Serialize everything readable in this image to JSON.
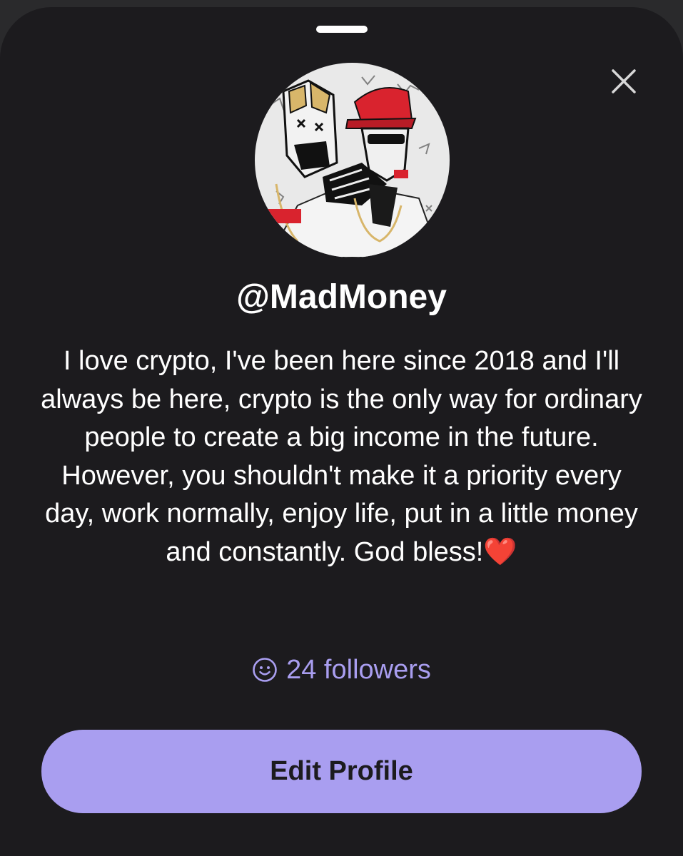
{
  "profile": {
    "username": "@MadMoney",
    "bio": "I love crypto, I've been here since 2018 and I'll always be here, crypto is the only way for ordinary people to create a big income in the future. However, you shouldn't make it a priority every day, work normally, enjoy life, put in a little money and constantly. God bless!❤️",
    "followers_label": "24 followers",
    "followers_count": 24,
    "avatar_icon": "avatar-image"
  },
  "actions": {
    "edit_label": "Edit Profile",
    "close_icon": "close-icon"
  },
  "icons": {
    "followers_icon": "smiley-face-icon"
  },
  "colors": {
    "sheet_background": "#1c1b1e",
    "accent": "#a99ef0",
    "text_primary": "#ffffff"
  }
}
